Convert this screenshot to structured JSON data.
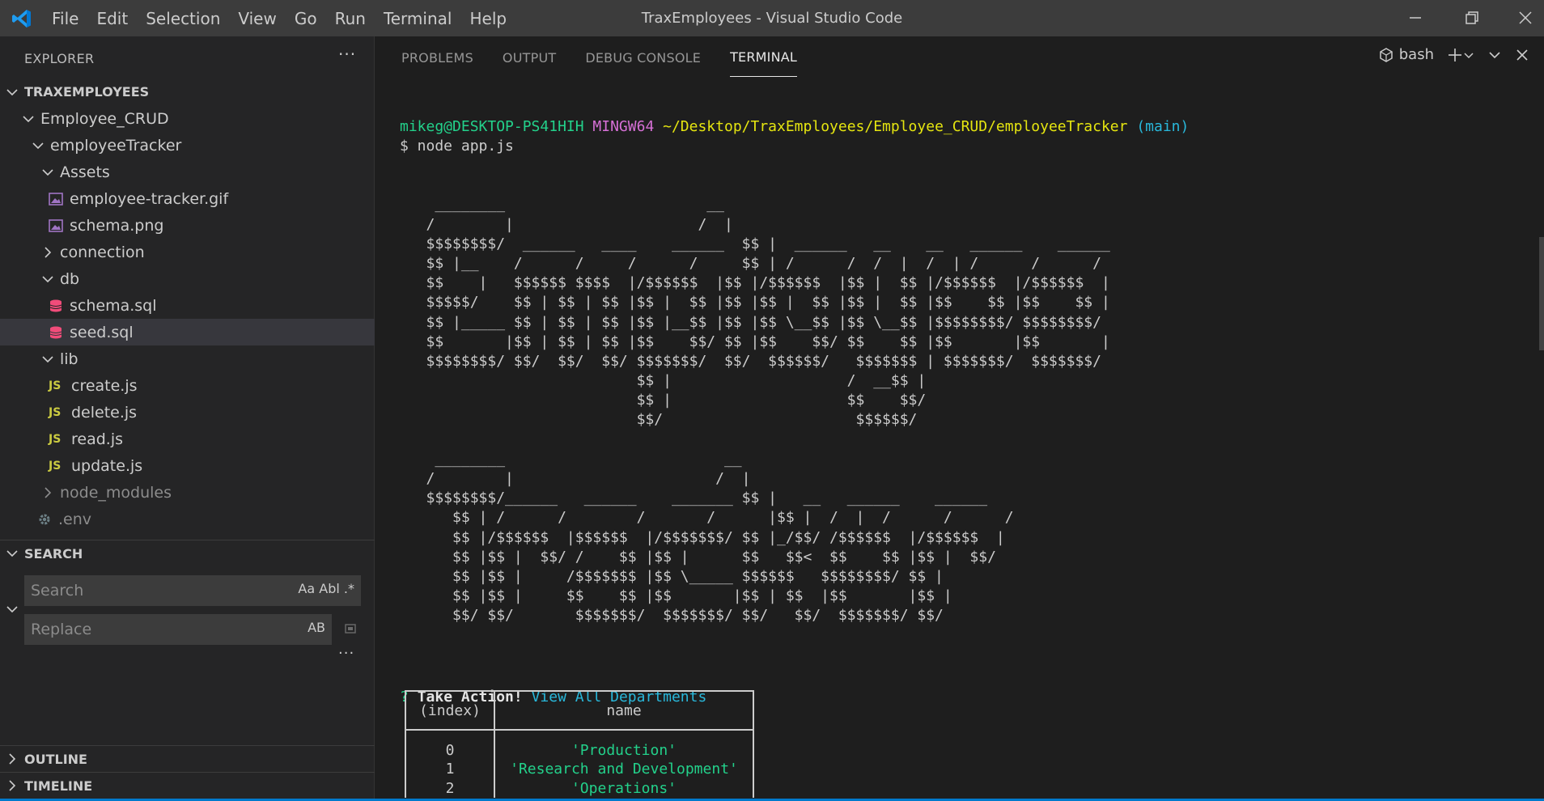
{
  "window": {
    "title": "TraxEmployees - Visual Studio Code"
  },
  "menu": [
    "File",
    "Edit",
    "Selection",
    "View",
    "Go",
    "Run",
    "Terminal",
    "Help"
  ],
  "explorer": {
    "header": "EXPLORER",
    "root": "TRAXEMPLOYEES",
    "items": [
      {
        "label": "Employee_CRUD",
        "type": "folder-open",
        "depth": 1
      },
      {
        "label": "employeeTracker",
        "type": "folder-open",
        "depth": 2
      },
      {
        "label": "Assets",
        "type": "folder-open",
        "depth": 3
      },
      {
        "label": "employee-tracker.gif",
        "type": "image",
        "depth": 4
      },
      {
        "label": "schema.png",
        "type": "image",
        "depth": 4
      },
      {
        "label": "connection",
        "type": "folder-closed",
        "depth": 3
      },
      {
        "label": "db",
        "type": "folder-open",
        "depth": 3
      },
      {
        "label": "schema.sql",
        "type": "database",
        "depth": 4
      },
      {
        "label": "seed.sql",
        "type": "database",
        "depth": 4,
        "selected": true
      },
      {
        "label": "lib",
        "type": "folder-open",
        "depth": 3
      },
      {
        "label": "create.js",
        "type": "js",
        "depth": 4
      },
      {
        "label": "delete.js",
        "type": "js",
        "depth": 4
      },
      {
        "label": "read.js",
        "type": "js",
        "depth": 4
      },
      {
        "label": "update.js",
        "type": "js",
        "depth": 4
      },
      {
        "label": "node_modules",
        "type": "folder-closed",
        "depth": 3,
        "dim": true
      },
      {
        "label": ".env",
        "type": "gear",
        "depth": 3,
        "dim": true
      }
    ]
  },
  "search": {
    "header": "SEARCH",
    "search_placeholder": "Search",
    "replace_placeholder": "Replace",
    "opts_search": "Aa  Abl",
    "opts_replace": "AB"
  },
  "outline": {
    "label": "OUTLINE"
  },
  "timeline": {
    "label": "TIMELINE"
  },
  "panel": {
    "tabs": [
      "PROBLEMS",
      "OUTPUT",
      "DEBUG CONSOLE",
      "TERMINAL"
    ],
    "active_tab": "TERMINAL",
    "shell": "bash"
  },
  "terminal": {
    "prompt_user": "mikeg@DESKTOP-PS41HIH",
    "prompt_env": "MINGW64",
    "prompt_path": "~/Desktop/TraxEmployees/Employee_CRUD/employeeTracker",
    "prompt_branch": "(main)",
    "command": "$ node app.js",
    "ascii_art": [
      "    ________                       __",
      "   /        |                     /  |",
      "   $$$$$$$$/  ______   ____    ______  $$ |  ______   __    __   ______    ______",
      "   $$ |__    /      /     /      /     $$ | /      /  /  |  /  | /      /      /",
      "   $$    |   $$$$$$ $$$$  |/$$$$$$  |$$ |/$$$$$$  |$$ |  $$ |/$$$$$$  |/$$$$$$  |",
      "   $$$$$/    $$ | $$ | $$ |$$ |  $$ |$$ |$$ |  $$ |$$ |  $$ |$$    $$ |$$    $$ |",
      "   $$ |_____ $$ | $$ | $$ |$$ |__$$ |$$ |$$ \\__$$ |$$ \\__$$ |$$$$$$$$/ $$$$$$$$/",
      "   $$       |$$ | $$ | $$ |$$    $$/ $$ |$$    $$/ $$    $$ |$$       |$$       |",
      "   $$$$$$$$/ $$/  $$/  $$/ $$$$$$$/  $$/  $$$$$$/   $$$$$$$ | $$$$$$$/  $$$$$$$/",
      "                           $$ |                    /  __$$ |",
      "                           $$ |                    $$    $$/",
      "                           $$/                      $$$$$$/",
      "",
      "    ________                         __",
      "   /        |                       /  |",
      "   $$$$$$$$/______   ______    _______ $$ |   __   ______    ______",
      "      $$ | /      /        /       /      |$$ |  /  |  /      /      /",
      "      $$ |/$$$$$$  |$$$$$$  |/$$$$$$$/ $$ |_/$$/ /$$$$$$  |/$$$$$$  |",
      "      $$ |$$ |  $$/ /    $$ |$$ |      $$   $$<  $$    $$ |$$ |  $$/",
      "      $$ |$$ |     /$$$$$$$ |$$ \\_____ $$$$$$   $$$$$$$$/ $$ |",
      "      $$ |$$ |     $$    $$ |$$       |$$ | $$  |$$       |$$ |",
      "      $$/ $$/       $$$$$$$/  $$$$$$$/ $$/   $$/  $$$$$$$/ $$/"
    ],
    "question_mark": "?",
    "question": "Take Action!",
    "answer": "View All Departments"
  },
  "table": {
    "headers": [
      "(index)",
      "name"
    ],
    "rows": [
      {
        "index": "0",
        "name": "'Production'"
      },
      {
        "index": "1",
        "name": "'Research and Development'"
      },
      {
        "index": "2",
        "name": "'Operations'"
      }
    ]
  },
  "colors": {
    "titlebar": "#3c3c3c",
    "sidebar": "#252526",
    "editor": "#1e1e1e",
    "accent": "#007acc",
    "terminal_green": "#23d18b",
    "terminal_magenta": "#d670d6",
    "terminal_yellow": "#e5e510",
    "terminal_cyan": "#29b8db"
  }
}
